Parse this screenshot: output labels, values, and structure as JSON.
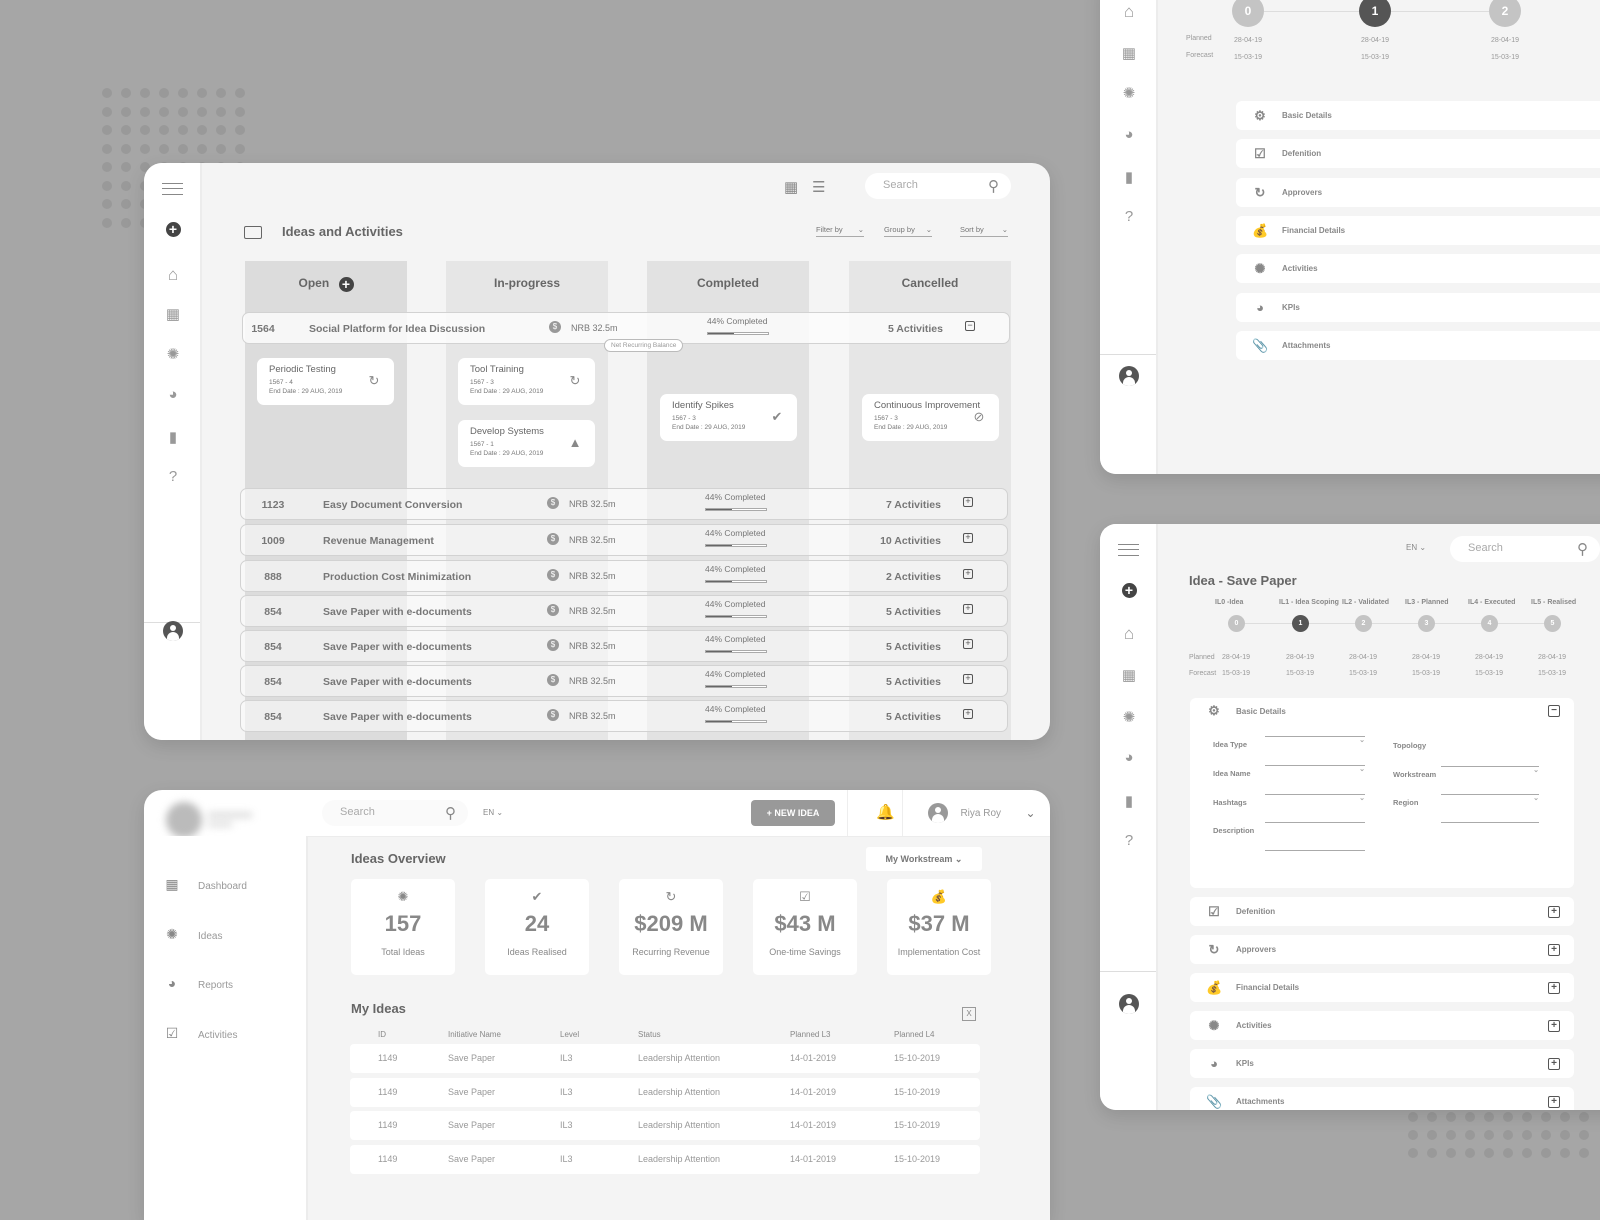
{
  "kanban": {
    "title": "Ideas and Activities",
    "search_placeholder": "Search",
    "filters": {
      "filter_by": "Filter by",
      "group_by": "Group by",
      "sort_by": "Sort by"
    },
    "columns": [
      "Open",
      "In-progress",
      "Completed",
      "Cancelled"
    ],
    "expanded_row": {
      "id": "1564",
      "name": "Social Platform for Idea Discussion",
      "nrb": "NRB 32.5m",
      "progress_label": "44% Completed",
      "progress": 0.44,
      "activities": "5 Activities",
      "toggle": "−"
    },
    "tooltip": "Net Recurring Balance",
    "cards": [
      {
        "title": "Periodic Testing",
        "code": "1567 - 4",
        "end": "End Date : 29 AUG, 2019",
        "icon": "sync-icon",
        "column": "Open"
      },
      {
        "title": "Tool Training",
        "code": "1567 - 3",
        "end": "End Date : 29 AUG, 2019",
        "icon": "sync-icon",
        "column": "In-progress"
      },
      {
        "title": "Develop Systems",
        "code": "1567 - 1",
        "end": "End Date : 29 AUG, 2019",
        "icon": "warning-icon",
        "column": "In-progress"
      },
      {
        "title": "Identify Spikes",
        "code": "1567 - 3",
        "end": "End Date : 29 AUG, 2019",
        "icon": "check-circle-icon",
        "column": "Completed"
      },
      {
        "title": "Continuous Improvement",
        "code": "1567 - 3",
        "end": "End Date : 29 AUG, 2019",
        "icon": "ban-icon",
        "column": "Cancelled"
      }
    ],
    "rows": [
      {
        "id": "1123",
        "name": "Easy Document Conversion",
        "nrb": "NRB 32.5m",
        "progress_label": "44% Completed",
        "progress": 0.44,
        "activities": "7 Activities",
        "toggle": "+"
      },
      {
        "id": "1009",
        "name": "Revenue Management",
        "nrb": "NRB 32.5m",
        "progress_label": "44% Completed",
        "progress": 0.44,
        "activities": "10 Activities",
        "toggle": "+"
      },
      {
        "id": "888",
        "name": "Production Cost Minimization",
        "nrb": "NRB 32.5m",
        "progress_label": "44% Completed",
        "progress": 0.44,
        "activities": "2 Activities",
        "toggle": "+"
      },
      {
        "id": "854",
        "name": "Save Paper with e-documents",
        "nrb": "NRB 32.5m",
        "progress_label": "44% Completed",
        "progress": 0.44,
        "activities": "5 Activities",
        "toggle": "+"
      },
      {
        "id": "854",
        "name": "Save Paper with e-documents",
        "nrb": "NRB 32.5m",
        "progress_label": "44% Completed",
        "progress": 0.44,
        "activities": "5 Activities",
        "toggle": "+"
      },
      {
        "id": "854",
        "name": "Save Paper with e-documents",
        "nrb": "NRB 32.5m",
        "progress_label": "44% Completed",
        "progress": 0.44,
        "activities": "5 Activities",
        "toggle": "+"
      },
      {
        "id": "854",
        "name": "Save Paper with e-documents",
        "nrb": "NRB 32.5m",
        "progress_label": "44% Completed",
        "progress": 0.44,
        "activities": "5 Activities",
        "toggle": "+"
      }
    ]
  },
  "detail_top": {
    "steps": [
      "0",
      "1",
      "2"
    ],
    "active_step": 1,
    "planned_label": "Planned",
    "forecast_label": "Forecast",
    "planned": [
      "28-04-19",
      "28-04-19",
      "28-04-19"
    ],
    "forecast": [
      "15-03-19",
      "15-03-19",
      "15-03-19"
    ],
    "sections": [
      "Basic Details",
      "Defenition",
      "Approvers",
      "Financial Details",
      "Activities",
      "KPIs",
      "Attachments"
    ]
  },
  "detail": {
    "lang": "EN",
    "search_placeholder": "Search",
    "title": "Idea - Save Paper",
    "stage_labels": [
      "IL0 -Idea",
      "IL1 - Idea Scoping",
      "IL2 - Validated",
      "IL3 - Planned",
      "IL4 - Executed",
      "IL5 - Realised"
    ],
    "steps": [
      "0",
      "1",
      "2",
      "3",
      "4",
      "5"
    ],
    "active_step": 1,
    "planned_label": "Planned",
    "forecast_label": "Forecast",
    "planned": [
      "28-04-19",
      "28-04-19",
      "28-04-19",
      "28-04-19",
      "28-04-19",
      "28-04-19"
    ],
    "forecast": [
      "15-03-19",
      "15-03-19",
      "15-03-19",
      "15-03-19",
      "15-03-19",
      "15-03-19"
    ],
    "basic": {
      "label": "Basic Details",
      "fields_left": [
        "Idea Type",
        "Idea Name",
        "Hashtags",
        "Description"
      ],
      "fields_right": [
        "Topology",
        "Workstream",
        "Region"
      ]
    },
    "sections": [
      "Defenition",
      "Approvers",
      "Financial Details",
      "Activities",
      "KPIs",
      "Attachments"
    ]
  },
  "overview": {
    "search_placeholder": "Search",
    "lang": "EN",
    "new_idea": "+ NEW IDEA",
    "user": "Riya Roy",
    "nav": [
      "Dashboard",
      "Ideas",
      "Reports",
      "Activities"
    ],
    "title": "Ideas Overview",
    "workstream": "My Workstream",
    "kpis": [
      {
        "value": "157",
        "label": "Total Ideas",
        "icon": "lightbulb-icon"
      },
      {
        "value": "24",
        "label": "Ideas Realised",
        "icon": "check-circle-icon"
      },
      {
        "value": "$209 M",
        "label": "Recurring Revenue",
        "icon": "sync-icon"
      },
      {
        "value": "$43 M",
        "label": "One-time Savings",
        "icon": "hand-check-icon"
      },
      {
        "value": "$37 M",
        "label": "Implementation Cost",
        "icon": "money-bag-icon"
      }
    ],
    "my_ideas": "My Ideas",
    "table_headers": [
      "ID",
      "Initiative Name",
      "Level",
      "Status",
      "Planned L3",
      "Planned L4"
    ],
    "table_rows": [
      [
        "1149",
        "Save Paper",
        "IL3",
        "Leadership Attention",
        "14-01-2019",
        "15-10-2019"
      ],
      [
        "1149",
        "Save Paper",
        "IL3",
        "Leadership Attention",
        "14-01-2019",
        "15-10-2019"
      ],
      [
        "1149",
        "Save Paper",
        "IL3",
        "Leadership Attention",
        "14-01-2019",
        "15-10-2019"
      ],
      [
        "1149",
        "Save Paper",
        "IL3",
        "Leadership Attention",
        "14-01-2019",
        "15-10-2019"
      ]
    ]
  }
}
